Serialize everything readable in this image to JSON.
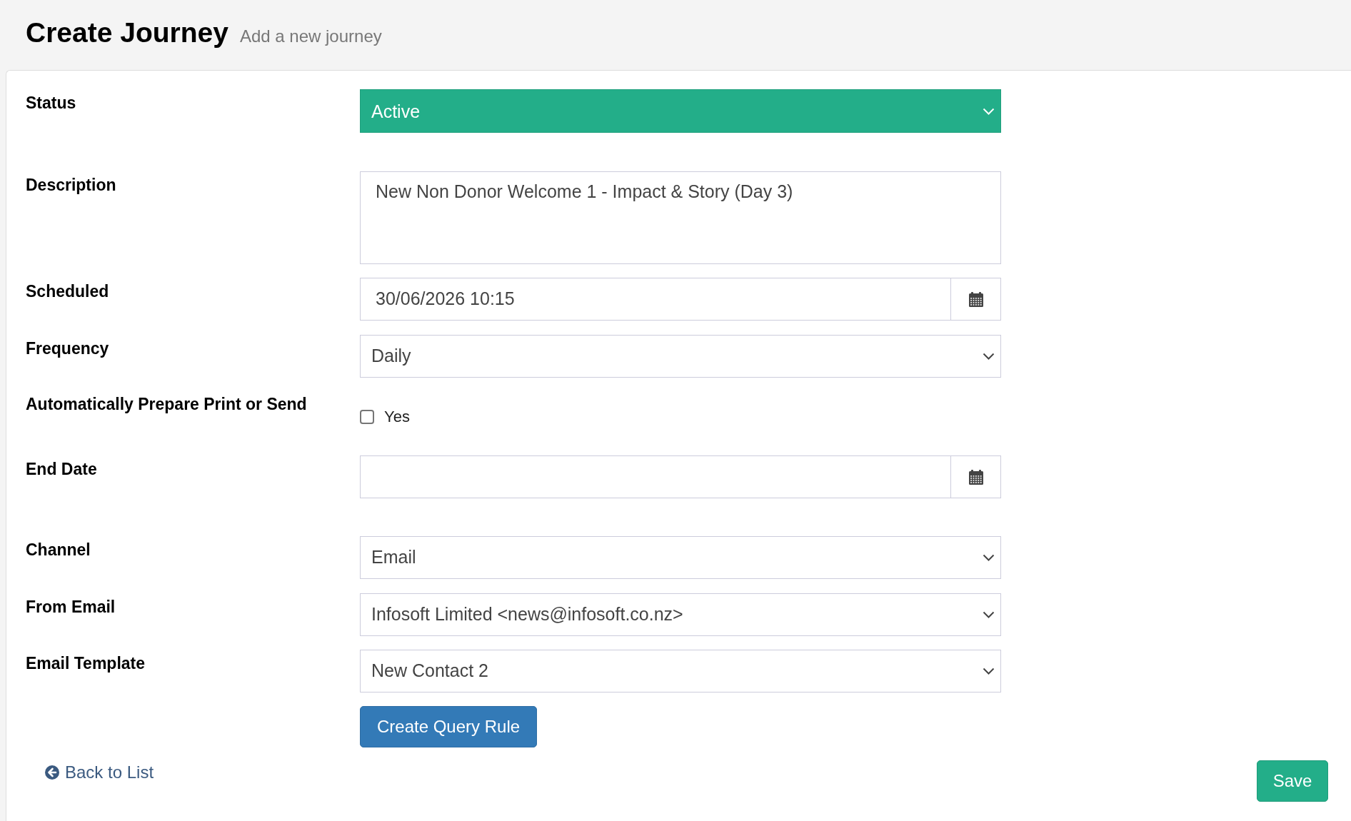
{
  "header": {
    "title": "Create Journey",
    "subtitle": "Add a new journey"
  },
  "form": {
    "fields": [
      {
        "kind": "status_select",
        "label": "Status",
        "value": "Active"
      },
      {
        "kind": "textarea",
        "label": "Description",
        "value": "New Non Donor Welcome 1 - Impact & Story (Day 3)"
      },
      {
        "kind": "date",
        "label": "Scheduled",
        "value": "30/06/2026 10:15"
      },
      {
        "kind": "select",
        "label": "Frequency",
        "value": "Daily"
      },
      {
        "kind": "checkbox",
        "label": "Automatically Prepare Print or Send",
        "option": "Yes",
        "checked": false
      },
      {
        "kind": "date",
        "label": "End Date"
      },
      {
        "kind": "select",
        "label": "Channel",
        "value": "Email"
      },
      {
        "kind": "select",
        "label": "From Email",
        "value": "Infosoft Limited <news@infosoft.co.nz>"
      },
      {
        "kind": "select",
        "label": "Email Template",
        "value": "New Contact 2"
      }
    ],
    "query_rule_button": "Create Query Rule"
  },
  "footer": {
    "back_link": "Back to List",
    "save_button": "Save"
  }
}
